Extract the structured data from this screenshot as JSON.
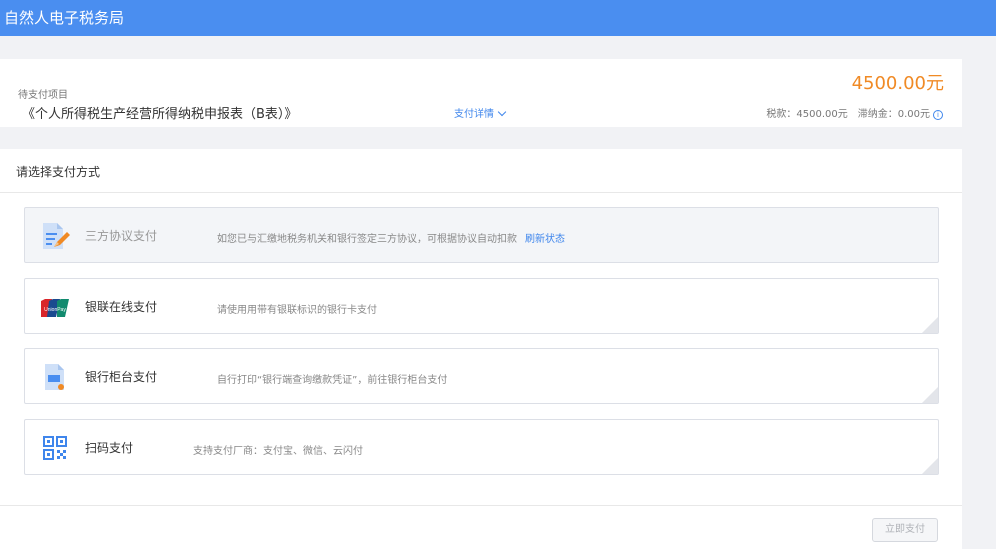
{
  "header": {
    "title": "自然人电子税务局"
  },
  "summary": {
    "pending_label": "待支付项目",
    "item_name": "《个人所得税生产经营所得纳税申报表（B表）》",
    "detail_link": "支付详情",
    "amount": "4500.00元",
    "breakdown": "税款：4500.00元　滞纳金：0.00元"
  },
  "payment": {
    "title": "请选择支付方式",
    "options": [
      {
        "label": "三方协议支付",
        "desc": "如您已与汇缴地税务机关和银行签定三方协议，可根据协议自动扣款",
        "action": "刷新状态",
        "icon": "document-pen-icon",
        "disabled": true
      },
      {
        "label": "银联在线支付",
        "desc": "请使用用带有银联标识的银行卡支付",
        "icon": "unionpay-icon"
      },
      {
        "label": "银行柜台支付",
        "desc": "自行打印“银行端查询缴款凭证”，前往银行柜台支付",
        "icon": "print-document-icon"
      },
      {
        "label": "扫码支付",
        "desc": "支持支付厂商：支付宝、微信、云闪付",
        "icon": "qr-code-icon"
      }
    ],
    "pay_button": "立即支付"
  },
  "colors": {
    "header": "#4a8ef0",
    "amount": "#f08a25",
    "link": "#3f86ec"
  }
}
